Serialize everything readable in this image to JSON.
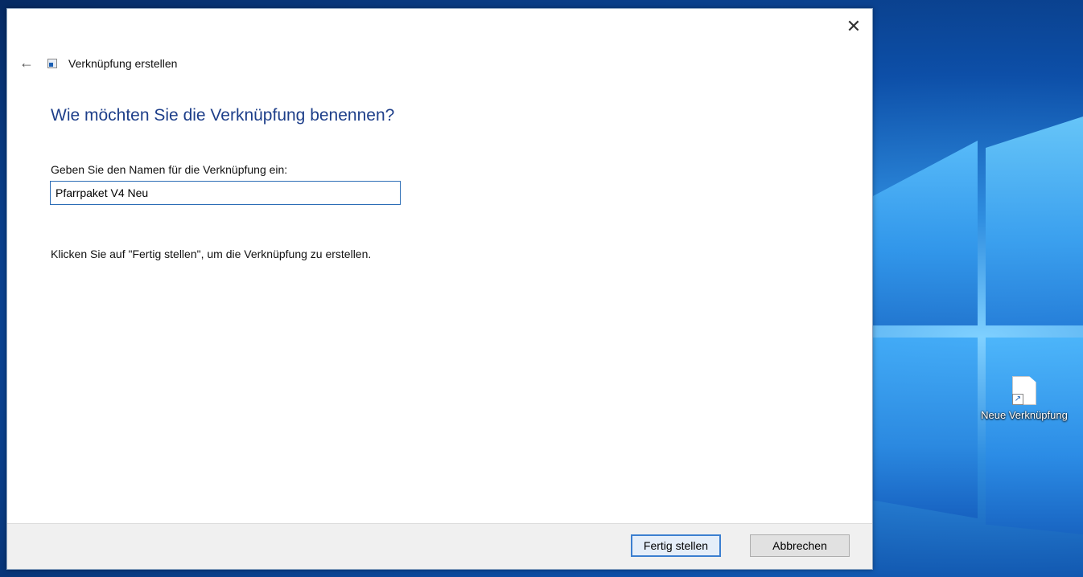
{
  "dialog": {
    "title": "Verknüpfung erstellen",
    "heading": "Wie möchten Sie die Verknüpfung benennen?",
    "field_label": "Geben Sie den Namen für die Verknüpfung ein:",
    "input_value": "Pfarrpaket V4 Neu",
    "hint": "Klicken Sie auf \"Fertig stellen\", um die Verknüpfung zu erstellen.",
    "close_glyph": "✕",
    "back_glyph": "←",
    "buttons": {
      "finish": "Fertig stellen",
      "cancel": "Abbrechen"
    }
  },
  "desktop": {
    "icon_label": "Neue Verknüpfung"
  },
  "icons": {
    "back": "back-arrow-icon",
    "title": "shortcut-icon",
    "close": "close-icon",
    "desktop_file": "shortcut-file-icon"
  },
  "colors": {
    "heading": "#1e3f8a",
    "input_border": "#2c6db6",
    "primary_button_border": "#3b7fd0"
  }
}
